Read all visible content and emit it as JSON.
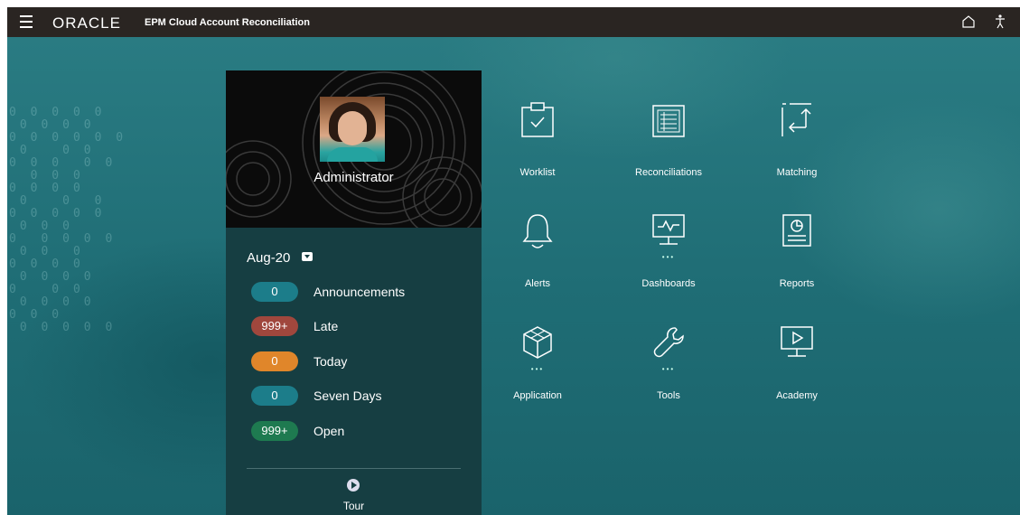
{
  "header": {
    "brand": "ORACLE",
    "app_title": "EPM Cloud Account Reconciliation"
  },
  "profile": {
    "username": "Administrator",
    "period": "Aug-20"
  },
  "stats": [
    {
      "count": "0",
      "label": "Announcements",
      "color": "#1c7d8a"
    },
    {
      "count": "999+",
      "label": "Late",
      "color": "#a0473d"
    },
    {
      "count": "0",
      "label": "Today",
      "color": "#e0862a"
    },
    {
      "count": "0",
      "label": "Seven Days",
      "color": "#1c7d8a"
    },
    {
      "count": "999+",
      "label": "Open",
      "color": "#1e7a50"
    }
  ],
  "tour_label": "Tour",
  "tiles": [
    {
      "label": "Worklist",
      "icon": "clipboard-check-icon"
    },
    {
      "label": "Reconciliations",
      "icon": "list-document-icon"
    },
    {
      "label": "Matching",
      "icon": "matching-arrows-icon"
    },
    {
      "label": "Alerts",
      "icon": "bell-icon"
    },
    {
      "label": "Dashboards",
      "icon": "monitor-chart-icon"
    },
    {
      "label": "Reports",
      "icon": "report-chart-icon"
    },
    {
      "label": "Application",
      "icon": "cube-icon"
    },
    {
      "label": "Tools",
      "icon": "wrench-icon"
    },
    {
      "label": "Academy",
      "icon": "presentation-play-icon"
    }
  ],
  "tile_more_indicator": "•••",
  "colors": {
    "topbar": "#2a2522",
    "panel": "#163e42",
    "background": "#1f6d75"
  }
}
